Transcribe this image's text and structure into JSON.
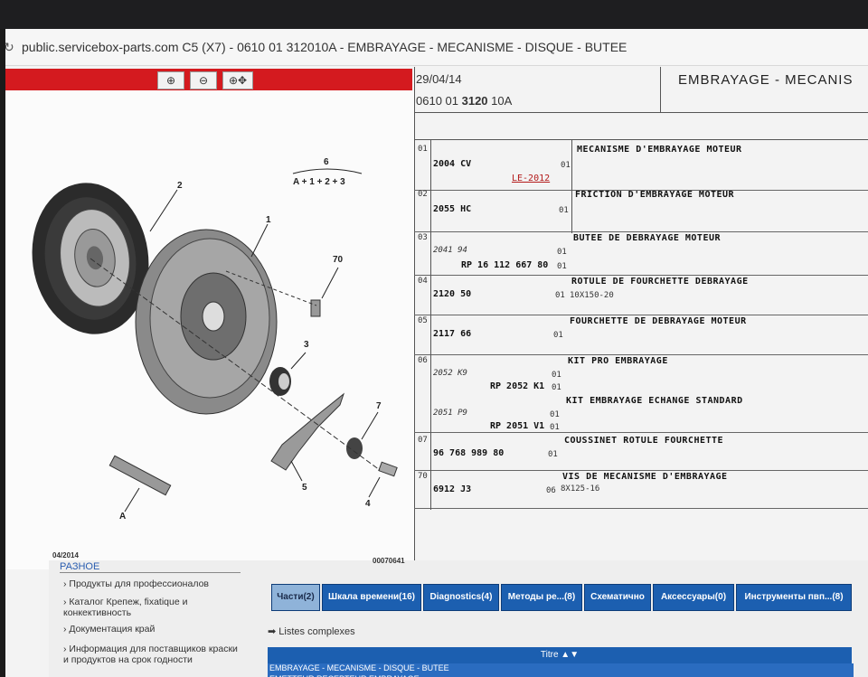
{
  "browser": {
    "url": "public.servicebox-parts.com C5 (X7) - 0610 01 312010A - EMBRAYAGE - MECANISME - DISQUE - BUTEE"
  },
  "toolbar": {
    "zoom_icons": [
      "zoom-in-icon",
      "zoom-out-icon",
      "pan-zoom-icon"
    ]
  },
  "header": {
    "date": "29/04/14",
    "ref_prefix": "0610 01 ",
    "ref_bold": "3120",
    "ref_suffix": " 10A",
    "title": "EMBRAYAGE - MECANIS"
  },
  "diagram": {
    "labels": {
      "l6": "6",
      "formula": "A + 1 + 2 + 3",
      "l2": "2",
      "l1": "1",
      "l70": "70",
      "l3": "3",
      "l7": "7",
      "l5": "5",
      "l4": "4",
      "lA": "A"
    },
    "footer_date": "04/2014",
    "footer_code": "00070641"
  },
  "parts": [
    {
      "num": "01",
      "code": "2004 CV",
      "qty": "01",
      "desc": "MECANISME D'EMBRAYAGE MOTEUR",
      "note": "LE-2012"
    },
    {
      "num": "02",
      "code": "2055 HC",
      "qty": "01",
      "desc": "FRICTION D'EMBRAYAGE MOTEUR"
    },
    {
      "num": "03",
      "code_italic": "2041 94",
      "qty1": "01",
      "code": "RP 16 112 667 80",
      "qty": "01",
      "desc": "BUTEE DE DEBRAYAGE MOTEUR"
    },
    {
      "num": "04",
      "code": "2120 50",
      "qty": "01",
      "desc": "ROTULE DE FOURCHETTE DEBRAYAGE",
      "sub": "10X150-20"
    },
    {
      "num": "05",
      "code": "2117 66",
      "qty": "01",
      "desc": "FOURCHETTE DE DEBRAYAGE MOTEUR"
    },
    {
      "num": "06",
      "code_italic": "2052 K9",
      "qty1": "01",
      "code": "RP 2052 K1",
      "qty": "01",
      "desc": "KIT PRO EMBRAYAGE",
      "code_italic2": "2051 P9",
      "qty2": "01",
      "code2": "RP 2051 V1",
      "qty3": "01",
      "desc2": "KIT EMBRAYAGE ECHANGE STANDARD"
    },
    {
      "num": "07",
      "code": "96 768 989 80",
      "qty": "01",
      "desc": "COUSSINET ROTULE FOURCHETTE"
    },
    {
      "num": "70",
      "code": "6912 J3",
      "qty": "06",
      "desc": "VIS DE MECANISME D'EMBRAYAGE",
      "sub": "8X125-16"
    }
  ],
  "sidebar": {
    "heading": "РАЗНОЕ",
    "links": [
      "Продукты для профессионалов",
      "Каталог Крепеж, fixatique и конкективность",
      "Документация край",
      "Информация для поставщиков краски и продуктов на срок годности"
    ]
  },
  "tabs": [
    "Части(2)",
    "Шкала времени(16)",
    "Diagnostics(4)",
    "Методы ре...(8)",
    "Схематично",
    "Аксессуары(0)",
    "Инструменты пвп...(8)"
  ],
  "listes": "Listes complexes",
  "table": {
    "head": "Titre ▲▼",
    "rows": [
      "EMBRAYAGE - MECANISME - DISQUE - BUTEE",
      "EMETTEUR RECEPTEUR EMBRAYAGE"
    ]
  },
  "colors": {
    "red_bar": "#d41a1f",
    "tab_blue": "#1c5fb0",
    "link_blue": "#2a5db0"
  }
}
